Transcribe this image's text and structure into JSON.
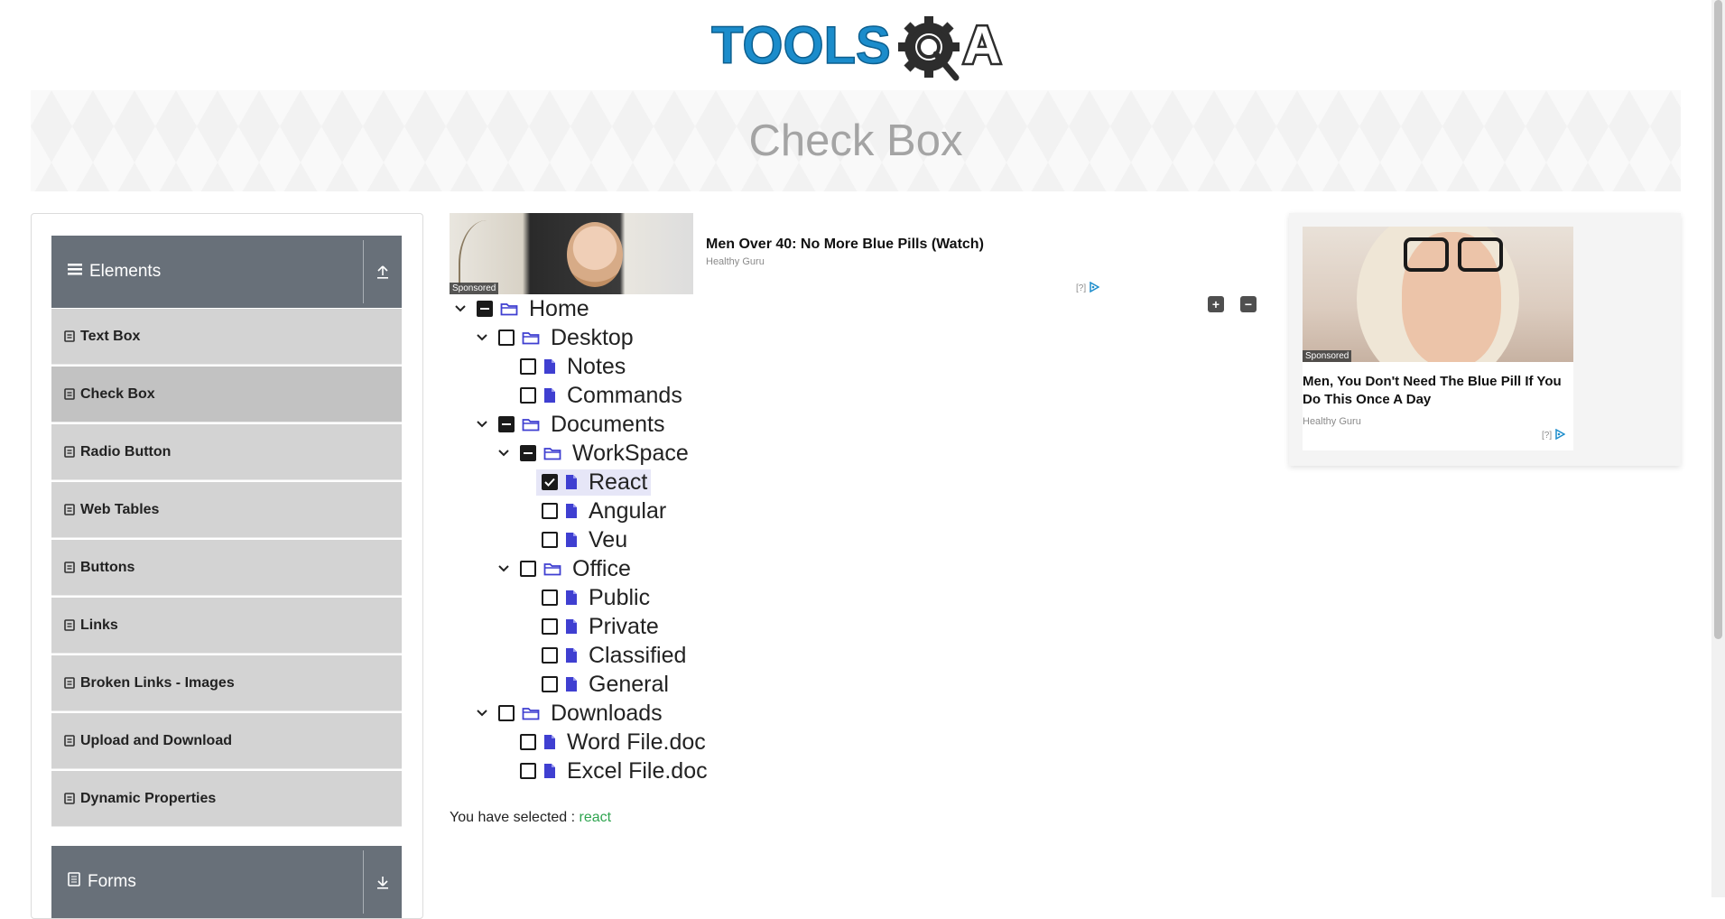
{
  "logo": {
    "text_main": "TOOLS",
    "text_tail": "A"
  },
  "page": {
    "title": "Check Box"
  },
  "sidebar": {
    "elements_group": {
      "label": "Elements",
      "icon": "list-icon",
      "toggle_icon": "upload-icon"
    },
    "items": [
      {
        "label": "Text Box",
        "active": false
      },
      {
        "label": "Check Box",
        "active": true
      },
      {
        "label": "Radio Button",
        "active": false
      },
      {
        "label": "Web Tables",
        "active": false
      },
      {
        "label": "Buttons",
        "active": false
      },
      {
        "label": "Links",
        "active": false
      },
      {
        "label": "Broken Links - Images",
        "active": false
      },
      {
        "label": "Upload and Download",
        "active": false
      },
      {
        "label": "Dynamic Properties",
        "active": false
      }
    ],
    "forms_group": {
      "label": "Forms",
      "icon": "document-icon",
      "toggle_icon": "download-icon"
    }
  },
  "ad_top": {
    "sponsored": "Sponsored",
    "title": "Men Over 40: No More Blue Pills (Watch)",
    "source": "Healthy Guru",
    "choice": "[?]"
  },
  "ad_side": {
    "sponsored": "Sponsored",
    "title": "Men, You Don't Need The Blue Pill If You Do This Once A Day",
    "source": "Healthy Guru",
    "choice": "[?]"
  },
  "tree": {
    "expand_all_icon": "plus-square-icon",
    "collapse_all_icon": "minus-square-icon",
    "nodes": [
      {
        "label": "Home",
        "type": "folder",
        "state": "half",
        "expanded": true
      },
      {
        "label": "Desktop",
        "type": "folder",
        "state": "off",
        "expanded": true
      },
      {
        "label": "Notes",
        "type": "file",
        "state": "off"
      },
      {
        "label": "Commands",
        "type": "file",
        "state": "off"
      },
      {
        "label": "Documents",
        "type": "folder",
        "state": "half",
        "expanded": true
      },
      {
        "label": "WorkSpace",
        "type": "folder",
        "state": "half",
        "expanded": true
      },
      {
        "label": "React",
        "type": "file",
        "state": "on"
      },
      {
        "label": "Angular",
        "type": "file",
        "state": "off"
      },
      {
        "label": "Veu",
        "type": "file",
        "state": "off"
      },
      {
        "label": "Office",
        "type": "folder",
        "state": "off",
        "expanded": true
      },
      {
        "label": "Public",
        "type": "file",
        "state": "off"
      },
      {
        "label": "Private",
        "type": "file",
        "state": "off"
      },
      {
        "label": "Classified",
        "type": "file",
        "state": "off"
      },
      {
        "label": "General",
        "type": "file",
        "state": "off"
      },
      {
        "label": "Downloads",
        "type": "folder",
        "state": "off",
        "expanded": true
      },
      {
        "label": "Word File.doc",
        "type": "file",
        "state": "off"
      },
      {
        "label": "Excel File.doc",
        "type": "file",
        "state": "off"
      }
    ]
  },
  "result": {
    "prefix": "You have selected :",
    "values": "react"
  },
  "colors": {
    "tree_icon": "#3f3fd1",
    "selected_value": "#2ea44f",
    "sidebar_header": "#687079"
  }
}
